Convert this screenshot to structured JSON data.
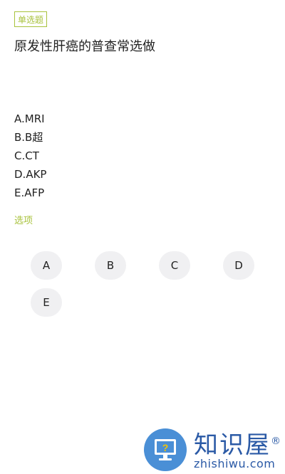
{
  "question": {
    "type_tag": "单选题",
    "text": "原发性肝癌的普查常选做"
  },
  "options": [
    "A.MRI",
    "B.B超",
    "C.CT",
    "D.AKP",
    "E.AFP"
  ],
  "answer_section": {
    "label": "选项",
    "choices": [
      "A",
      "B",
      "C",
      "D",
      "E"
    ]
  },
  "watermark": {
    "name": "知识屋",
    "reg_mark": "®",
    "domain": "zhishiwu.com",
    "icon": "question-monitor-icon"
  },
  "colors": {
    "accent": "#a8c23c",
    "choice_bg": "#f0f0f2",
    "watermark_blue": "#2b5aa6"
  }
}
